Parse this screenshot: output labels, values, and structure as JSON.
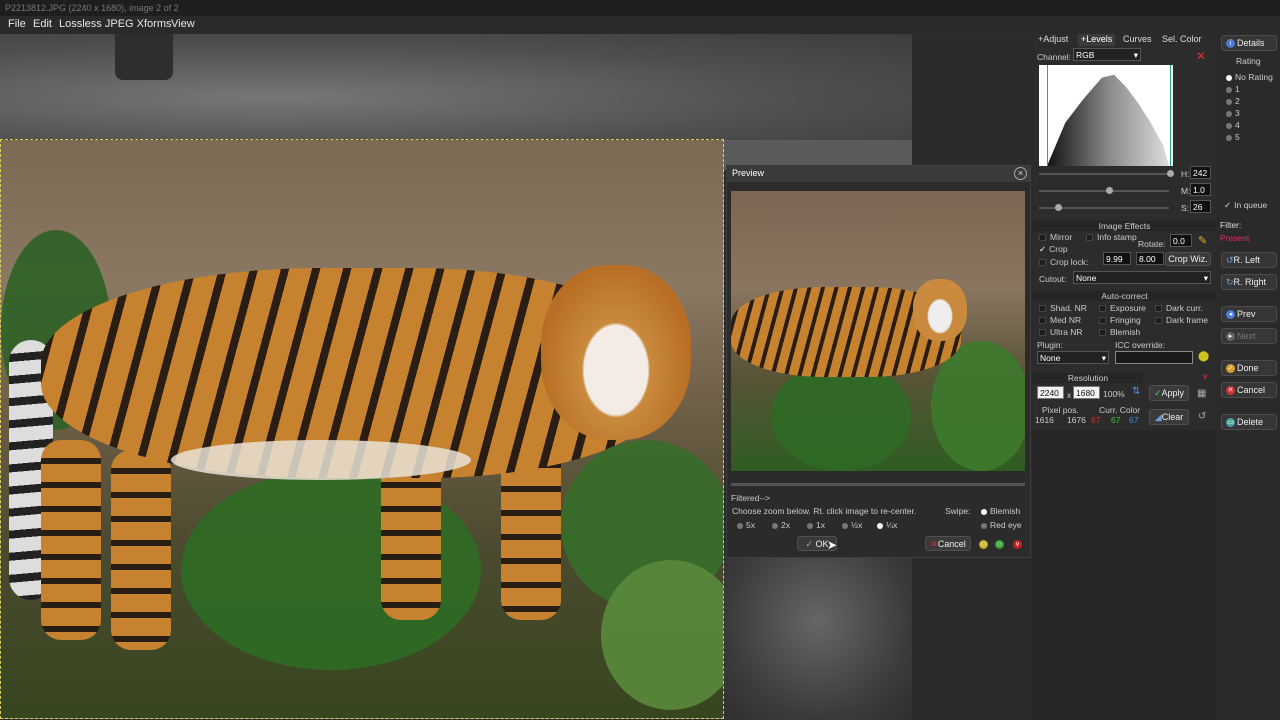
{
  "window": {
    "title": "P2213812.JPG (2240 x 1680), image 2 of 2"
  },
  "menu": [
    "File",
    "Edit",
    "Lossless JPEG Xforms",
    "View"
  ],
  "preview": {
    "title": "Preview",
    "filtered": "Filtered-->",
    "zoom_hint": "Choose zoom below.  Rt. click image to re-center.",
    "swipe_label": "Swipe:",
    "swipe_options": [
      "Blemish",
      "Red eye"
    ],
    "zoom_options": [
      "5x",
      "2x",
      "1x",
      "½x",
      "¼x"
    ],
    "ok": "OK",
    "cancel": "Cancel"
  },
  "panel": {
    "tabs": [
      "+Adjust",
      "+Levels",
      "Curves",
      "Sel. Color"
    ],
    "channel_label": "Channel:",
    "channel_value": "RGB",
    "h_label": "H:",
    "h_value": "242",
    "m_label": "M:",
    "m_value": "1.0",
    "s_label": "S:",
    "s_value": "26",
    "image_effects": "Image Effects",
    "mirror": "Mirror",
    "info_stamp": "Info stamp",
    "crop": "Crop",
    "rotate_label": "Rotate:",
    "rotate_value": "0.0",
    "crop_lock": "Crop lock:",
    "crop_w": "9.99",
    "crop_h": "8.00",
    "crop_wiz": "Crop Wiz.",
    "cutout_label": "Cutout:",
    "cutout_value": "None",
    "auto_correct": "Auto-correct",
    "shad_nr": "Shad. NR",
    "exposure": "Exposure",
    "dark_curr": "Dark curr.",
    "med_nr": "Med NR",
    "fringing": "Fringing",
    "dark_frame": "Dark frame",
    "ultra_nr": "Ultra NR",
    "blemish": "Blemish",
    "plugin_label": "Plugin:",
    "plugin_value": "None",
    "icc_label": "ICC override:",
    "resolution": "Resolution",
    "res_w": "2240",
    "res_x": "x",
    "res_h": "1680",
    "res_pct": "100%",
    "apply": "Apply",
    "clear": "Clear",
    "pixel_pos_label": "Pixel pos.",
    "pixel_x": "1616",
    "pixel_y": "1676",
    "curr_color_label": "Curr. Color",
    "color_r": "67",
    "color_g": "67",
    "color_b": "67"
  },
  "right": {
    "details": "Details",
    "rating_label": "Rating",
    "ratings": [
      "No Rating",
      "1",
      "2",
      "3",
      "4",
      "5"
    ],
    "in_queue": "In queue",
    "filter_label": "Filter:",
    "filter_value": "Present",
    "r_left": "R. Left",
    "r_right": "R. Right",
    "prev": "Prev",
    "next": "Next",
    "done": "Done",
    "cancel": "Cancel",
    "delete": "Delete"
  },
  "colors": {
    "accent_red": "#e03030",
    "filter_red": "#e03060",
    "green": "#40c040",
    "blue": "#4a8ad8"
  }
}
